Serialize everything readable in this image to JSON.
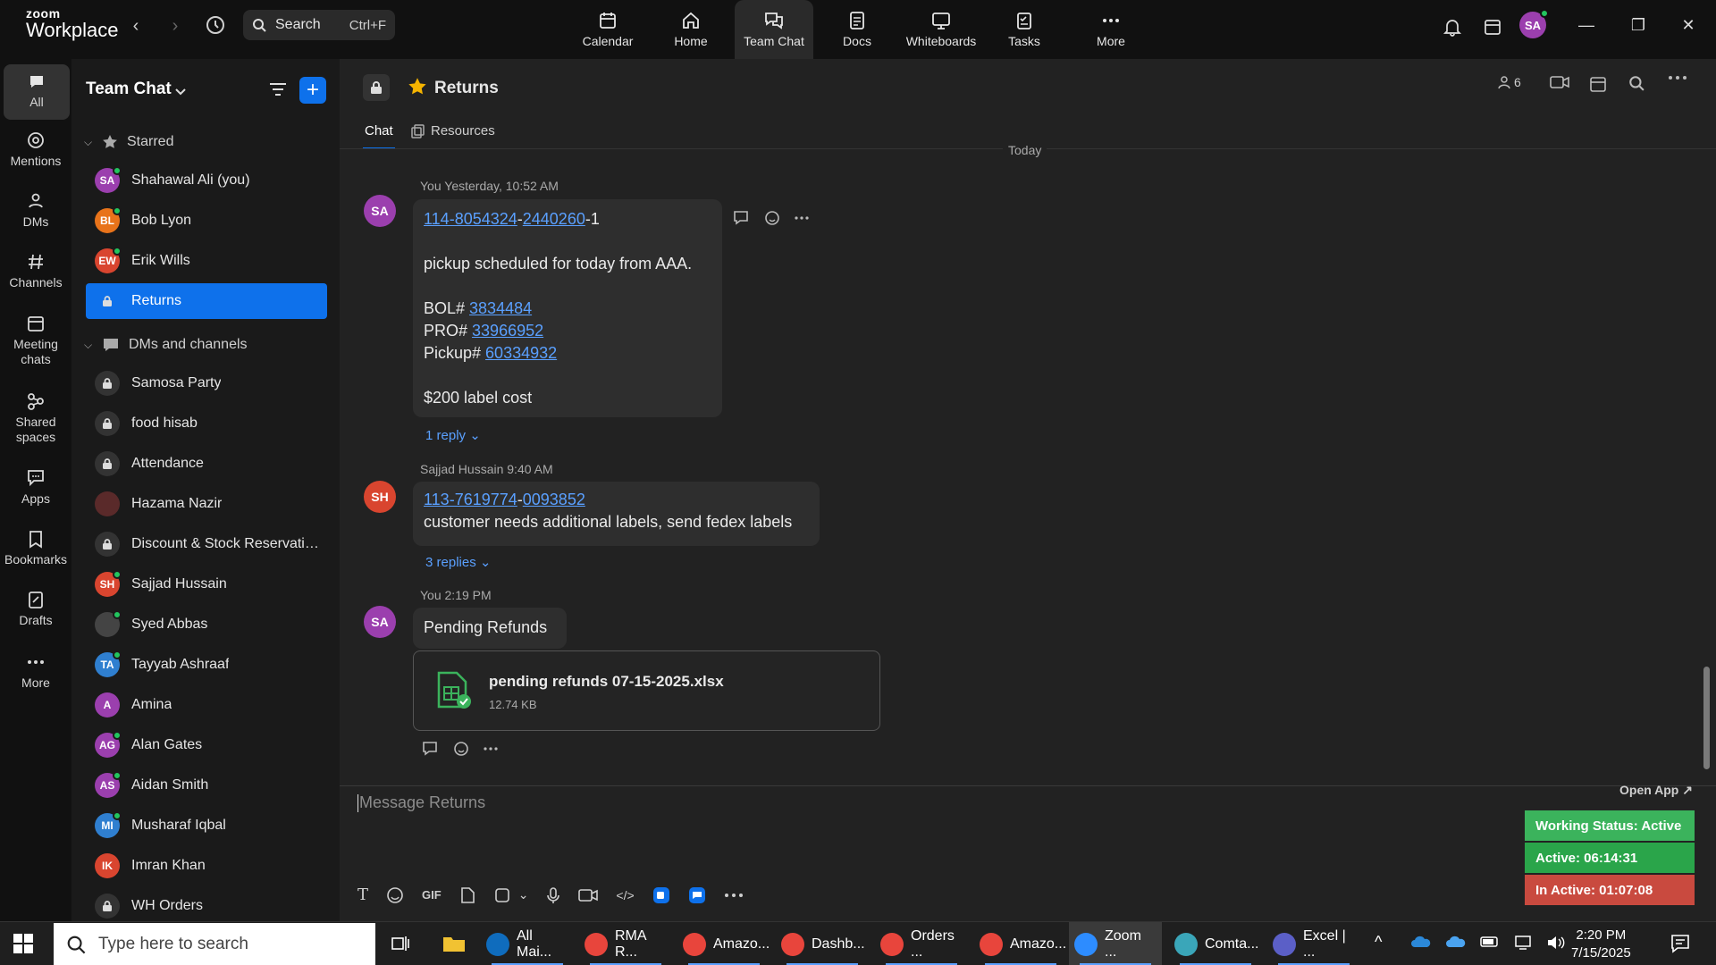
{
  "app": {
    "logo_line1": "zoom",
    "logo_line2": "Workplace"
  },
  "search": {
    "label": "Search",
    "shortcut": "Ctrl+F"
  },
  "nav_tabs": [
    {
      "label": "Calendar",
      "icon": "calendar-icon"
    },
    {
      "label": "Home",
      "icon": "home-icon"
    },
    {
      "label": "Team Chat",
      "icon": "chat-icon",
      "active": true
    },
    {
      "label": "Docs",
      "icon": "docs-icon"
    },
    {
      "label": "Whiteboards",
      "icon": "whiteboard-icon"
    },
    {
      "label": "Tasks",
      "icon": "tasks-icon"
    },
    {
      "label": "More",
      "icon": "more-icon"
    }
  ],
  "profile": {
    "initials": "SA",
    "color": "#9b3fae"
  },
  "rail": [
    {
      "label": "All",
      "icon": "chat-bubble-icon",
      "active": true
    },
    {
      "label": "Mentions",
      "icon": "at-icon"
    },
    {
      "label": "DMs",
      "icon": "people-icon"
    },
    {
      "label": "Channels",
      "icon": "hash-icon"
    },
    {
      "label": "Meeting chats",
      "icon": "calendar-chat-icon"
    },
    {
      "label": "Shared spaces",
      "icon": "shared-spaces-icon"
    },
    {
      "label": "Apps",
      "icon": "apps-icon"
    },
    {
      "label": "Bookmarks",
      "icon": "bookmark-icon"
    },
    {
      "label": "Drafts",
      "icon": "drafts-icon"
    },
    {
      "label": "More",
      "icon": "more-icon"
    }
  ],
  "sidebar": {
    "title": "Team Chat",
    "starred_label": "Starred",
    "starred": [
      {
        "name": "Shahawal Ali (you)",
        "initials": "SA",
        "color": "#9b3fae",
        "online": true
      },
      {
        "name": "Bob Lyon",
        "initials": "BL",
        "color": "#e8731a",
        "online": true
      },
      {
        "name": "Erik Wills",
        "initials": "EW",
        "color": "#d9452f",
        "online": true
      },
      {
        "name": "Returns",
        "lock": true,
        "active": true
      }
    ],
    "dms_label": "DMs and channels",
    "dms": [
      {
        "name": "Samosa Party",
        "lock": true
      },
      {
        "name": "food hisab",
        "lock": true
      },
      {
        "name": "Attendance",
        "lock": true
      },
      {
        "name": "Hazama Nazir",
        "initials": "",
        "color": "#5a2a2a",
        "photo": true
      },
      {
        "name": "Discount & Stock Reservatio...",
        "lock": true
      },
      {
        "name": "Sajjad Hussain",
        "initials": "SH",
        "color": "#d9452f",
        "online": true
      },
      {
        "name": "Syed Abbas",
        "initials": "",
        "color": "#444",
        "photo": true,
        "online": true
      },
      {
        "name": "Tayyab Ashraaf",
        "initials": "TA",
        "color": "#2f7fd0",
        "online": true
      },
      {
        "name": "Amina",
        "initials": "A",
        "color": "#9b3fae",
        "online": false
      },
      {
        "name": "Alan Gates",
        "initials": "AG",
        "color": "#9b3fae",
        "online": true
      },
      {
        "name": "Aidan Smith",
        "initials": "AS",
        "color": "#9b3fae",
        "online": true
      },
      {
        "name": "Musharaf Iqbal",
        "initials": "MI",
        "color": "#2f7fd0",
        "online": true
      },
      {
        "name": "Imran Khan",
        "initials": "IK",
        "color": "#d9452f",
        "online": false
      },
      {
        "name": "WH Orders",
        "lock": true
      }
    ]
  },
  "channel": {
    "name": "Returns",
    "tabs": [
      "Chat",
      "Resources"
    ],
    "member_count": "6",
    "today_label": "Today",
    "messages": [
      {
        "avatar": "SA",
        "avatar_color": "#9b3fae",
        "meta": "You Yesterday, 10:52 AM",
        "link1": "114-8054324",
        "sep1": "-",
        "link2": "2440260",
        "suffix1": "-1",
        "line_pickup": "pickup scheduled for today from AAA.",
        "bol_label": "BOL# ",
        "bol": "3834484",
        "pro_label": "PRO# ",
        "pro": "33966952",
        "pickup_label": "Pickup# ",
        "pickup": "60334932",
        "cost": "$200 label cost",
        "replies": "1 reply"
      },
      {
        "avatar": "SH",
        "avatar_color": "#d9452f",
        "meta": "Sajjad Hussain 9:40 AM",
        "link1": "113-7619774",
        "sep1": "-",
        "link2": "0093852",
        "text": "customer needs additional labels, send fedex labels",
        "replies": "3 replies"
      },
      {
        "avatar": "SA",
        "avatar_color": "#9b3fae",
        "meta": "You 2:19 PM",
        "text": "Pending Refunds",
        "file_name": "pending refunds 07-15-2025.xlsx",
        "file_size": "12.74 KB"
      }
    ],
    "composer_placeholder": "Message Returns"
  },
  "status_widget": {
    "open_app": "Open App ↗",
    "working_status": "Working Status: Active",
    "active": "Active: 06:14:31",
    "inactive": "In Active: 01:07:08",
    "colors": {
      "working": "#3bb35c",
      "active": "#2aa54a",
      "inactive": "#c94a3f"
    }
  },
  "taskbar": {
    "search_placeholder": "Type here to search",
    "apps": [
      {
        "label": "All Mai...",
        "icon": "outlook-icon",
        "color": "#0f6cbd"
      },
      {
        "label": "RMA R...",
        "icon": "chrome-icon",
        "color": "#e8453c"
      },
      {
        "label": "Amazo...",
        "icon": "chrome-icon",
        "color": "#e8453c"
      },
      {
        "label": "Dashb...",
        "icon": "chrome-icon",
        "color": "#e8453c"
      },
      {
        "label": "Orders ...",
        "icon": "chrome-icon",
        "color": "#e8453c"
      },
      {
        "label": "Amazo...",
        "icon": "chrome-icon",
        "color": "#e8453c"
      },
      {
        "label": "Zoom ...",
        "icon": "zoom-icon",
        "color": "#2d8cff",
        "active": true
      },
      {
        "label": "Comta...",
        "icon": "comtango-icon",
        "color": "#3aa6b9"
      },
      {
        "label": "Excel | ...",
        "icon": "teams-icon",
        "color": "#5b5fc7"
      }
    ],
    "time": "2:20 PM",
    "date": "7/15/2025"
  }
}
